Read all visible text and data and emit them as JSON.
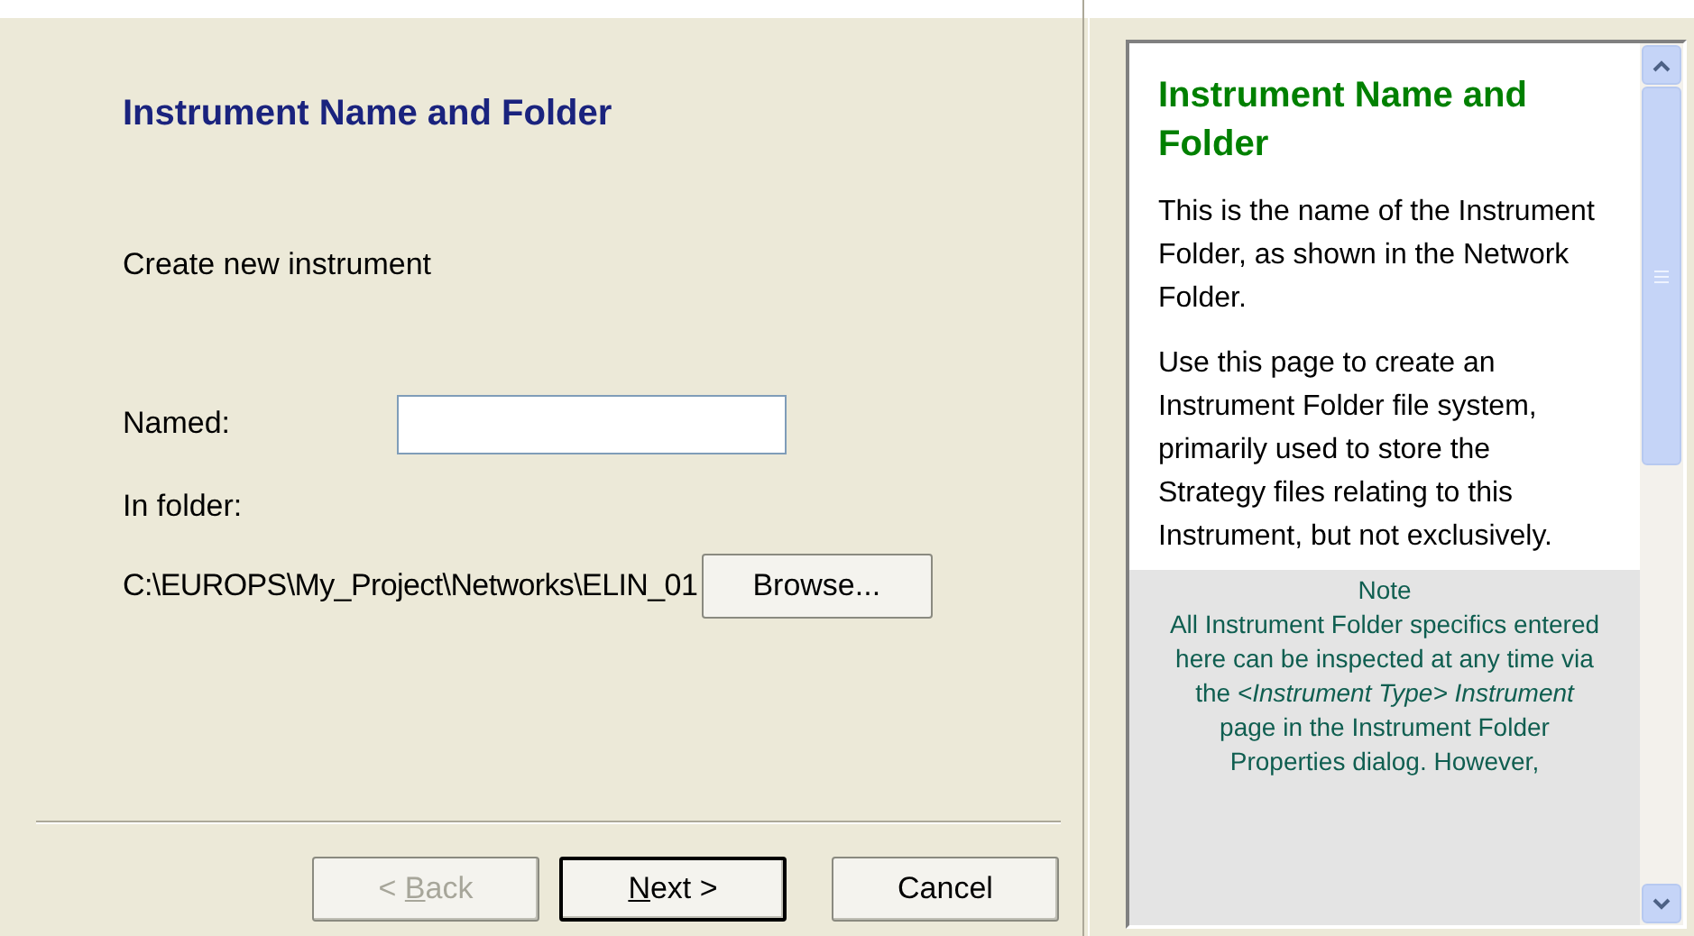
{
  "page": {
    "title": "Instrument Name and Folder",
    "subtitle": "Create new instrument"
  },
  "form": {
    "name_label": "Named:",
    "folder_label": "In folder:",
    "folder_path": "C:\\EUROPS\\My_Project\\Networks\\ELIN_01",
    "browse": "Browse..."
  },
  "buttons": [
    {
      "before": "< ",
      "key": "B",
      "after": "ack",
      "disabled": true,
      "default": false
    },
    {
      "key": "N",
      "after": "ext >",
      "disabled": false,
      "default": true
    },
    {
      "before": "Cancel",
      "disabled": false,
      "default": false
    }
  ],
  "help": {
    "title": "Instrument Name and Folder",
    "paragraphs": [
      "This is the name of the Instrument Folder, as shown in the Network Folder.",
      "Use this page to create an Instrument Folder file system, primarily used to store the Strategy files relating to this Instrument, but not exclusively."
    ],
    "note_title": "Note",
    "note": "All Instrument Folder specifics entered here can be inspected at any time via the *<Instrument Type> Instrument* page in the Instrument Folder Properties dialog.  However,"
  }
}
